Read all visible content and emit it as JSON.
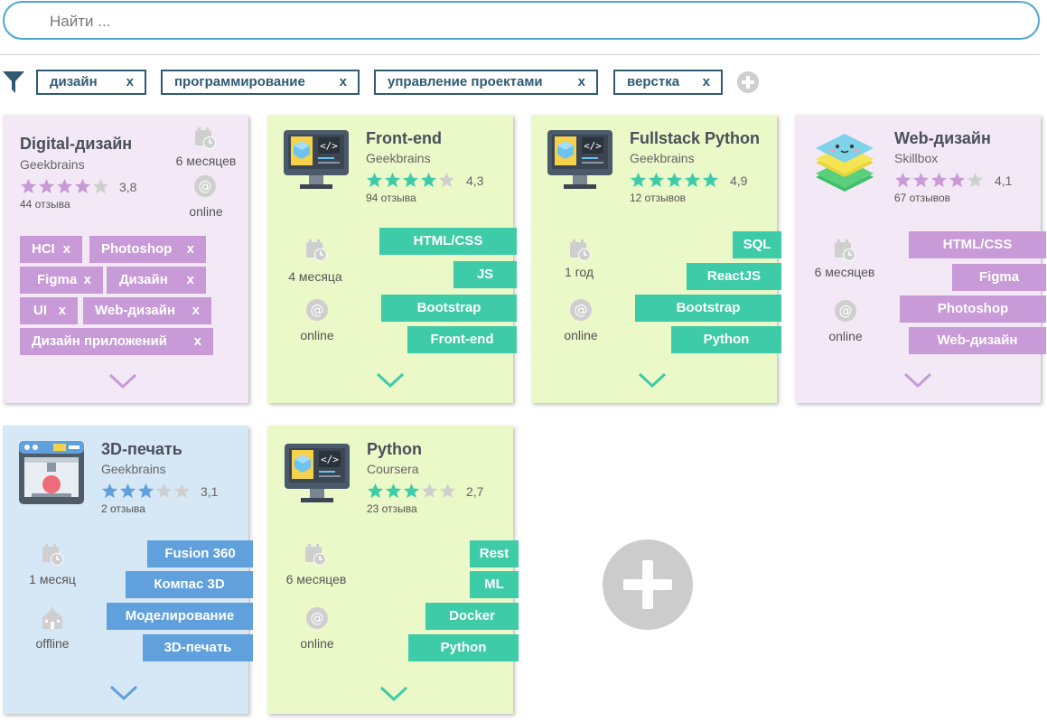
{
  "search": {
    "placeholder": "Найти ..."
  },
  "filters": [
    {
      "label": "дизайн",
      "remove": "x"
    },
    {
      "label": "программирование",
      "remove": "x"
    },
    {
      "label": "управление проектами",
      "remove": "x"
    },
    {
      "label": "верстка",
      "remove": "x"
    }
  ],
  "colors": {
    "lavender_bg": "#f2e8f6",
    "lime_bg": "#ebf8c8",
    "blue_bg": "#d6e7f5",
    "purple_tag": "#c89ad8",
    "teal_tag": "#3ecba8",
    "blue_tag": "#5fa0dd"
  },
  "cards": [
    {
      "title": "Digital-дизайн",
      "provider": "Geekbrains",
      "rating": "3,8",
      "rating_value": 3.8,
      "reviews": "44 отзыва",
      "duration": "6 месяцев",
      "format": "online",
      "tags": [
        {
          "label": "HCI",
          "remove": "x"
        },
        {
          "label": "Photoshop",
          "remove": "x"
        },
        {
          "label": "Figma",
          "remove": "x"
        },
        {
          "label": "Дизайн",
          "remove": "x"
        },
        {
          "label": "UI",
          "remove": "x"
        },
        {
          "label": "Web-дизайн",
          "remove": "x"
        },
        {
          "label": "Дизайн приложений",
          "remove": "x"
        }
      ]
    },
    {
      "title": "Front-end",
      "provider": "Geekbrains",
      "rating": "4,3",
      "rating_value": 4.3,
      "reviews": "94 отзыва",
      "duration": "4 месяца",
      "format": "online",
      "tags": [
        "HTML/CSS",
        "JS",
        "Bootstrap",
        "Front-end"
      ]
    },
    {
      "title": "Fullstack Python",
      "provider": "Geekbrains",
      "rating": "4,9",
      "rating_value": 4.9,
      "reviews": "12 отзывов",
      "duration": "1 год",
      "format": "online",
      "tags": [
        "SQL",
        "ReactJS",
        "Bootstrap",
        "Python"
      ]
    },
    {
      "title": "Web-дизайн",
      "provider": "Skillbox",
      "rating": "4,1",
      "rating_value": 4.1,
      "reviews": "67 отзывов",
      "duration": "6 месяцев",
      "format": "online",
      "tags": [
        "HTML/CSS",
        "Figma",
        "Photoshop",
        "Web-дизайн"
      ]
    },
    {
      "title": "3D-печать",
      "provider": "Geekbrains",
      "rating": "3,1",
      "rating_value": 3.1,
      "reviews": "2 отзыва",
      "duration": "1 месяц",
      "format": "offline",
      "tags": [
        "Fusion 360",
        "Компас 3D",
        "Моделирование",
        "3D-печать"
      ]
    },
    {
      "title": "Python",
      "provider": "Coursera",
      "rating": "2,7",
      "rating_value": 2.7,
      "reviews": "23 отзыва",
      "duration": "6 месяцев",
      "format": "online",
      "tags": [
        "Rest",
        "ML",
        "Docker",
        "Python"
      ]
    }
  ]
}
